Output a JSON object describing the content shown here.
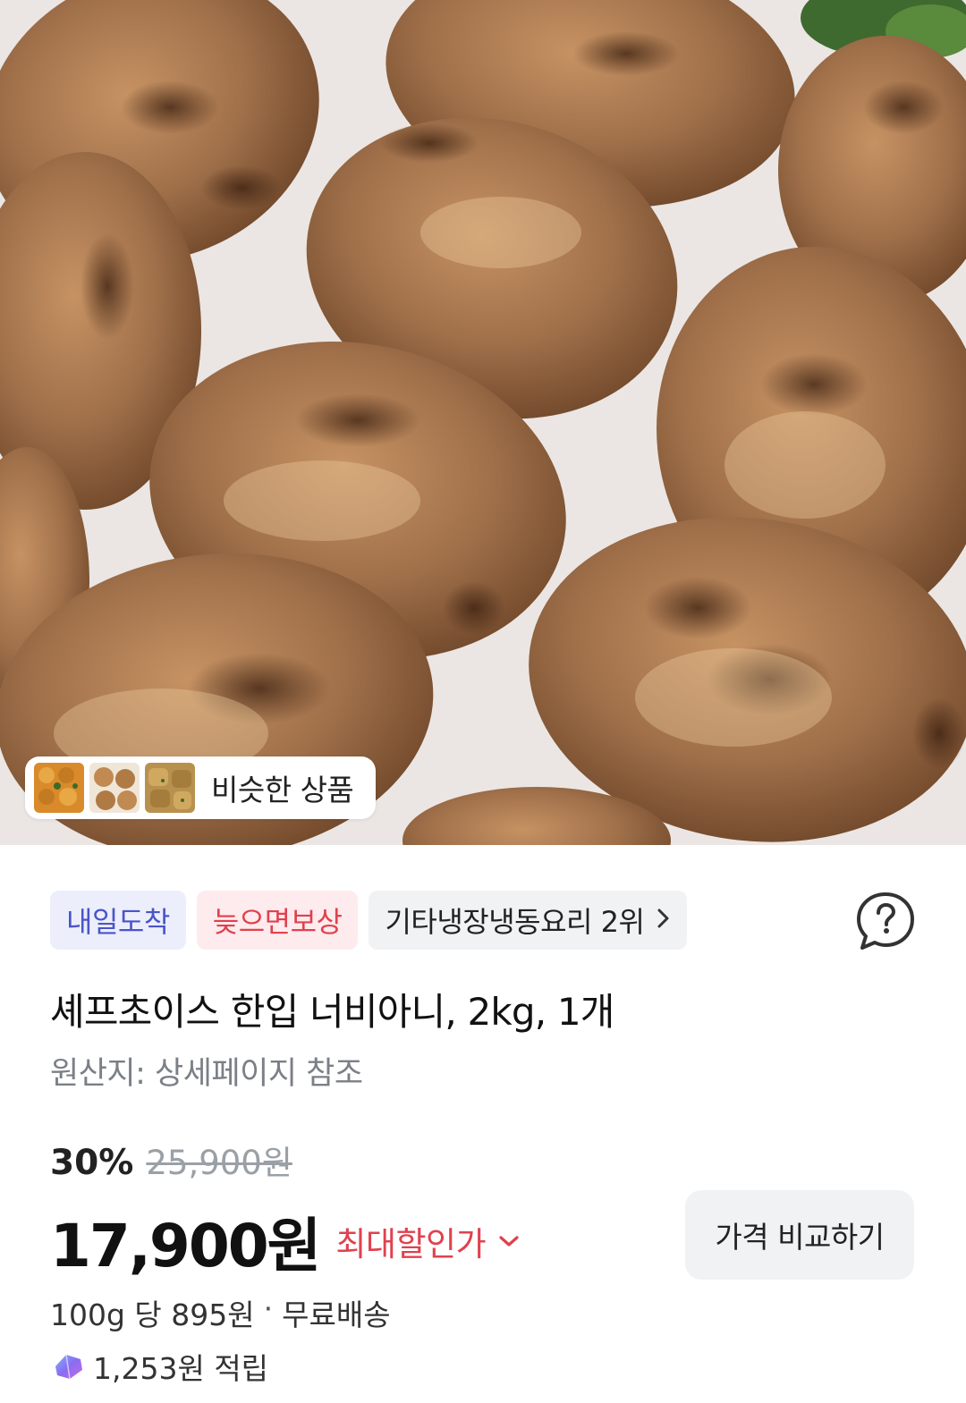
{
  "similar_products": {
    "label": "비슷한 상품",
    "thumbnails": [
      "similar-thumb-1",
      "similar-thumb-2",
      "similar-thumb-3"
    ]
  },
  "badges": {
    "arrival": "내일도착",
    "compensation": "늦으면보상",
    "ranking": "기타냉장냉동요리 2위"
  },
  "product": {
    "title": "셰프초이스 한입 너비아니, 2kg, 1개",
    "origin": "원산지: 상세페이지 참조"
  },
  "price": {
    "discount_percent": "30%",
    "original_price": "25,900원",
    "sale_price": "17,900원",
    "max_discount_label": "최대할인가",
    "compare_button": "가격 비교하기",
    "unit_price": "100g 당 895원",
    "separator": "·",
    "shipping": "무료배송",
    "points": "1,253원 적립"
  },
  "colors": {
    "accent_red": "#e0414e",
    "badge_blue_text": "#4a55c8",
    "badge_blue_bg": "#eceefc",
    "badge_red_bg": "#fdebed",
    "neutral_bg": "#f1f2f4"
  },
  "icons": {
    "help": "question-bubble-icon",
    "ranking_arrow": "chevron-right-icon",
    "max_discount_arrow": "chevron-down-icon",
    "points": "points-gem-icon"
  }
}
